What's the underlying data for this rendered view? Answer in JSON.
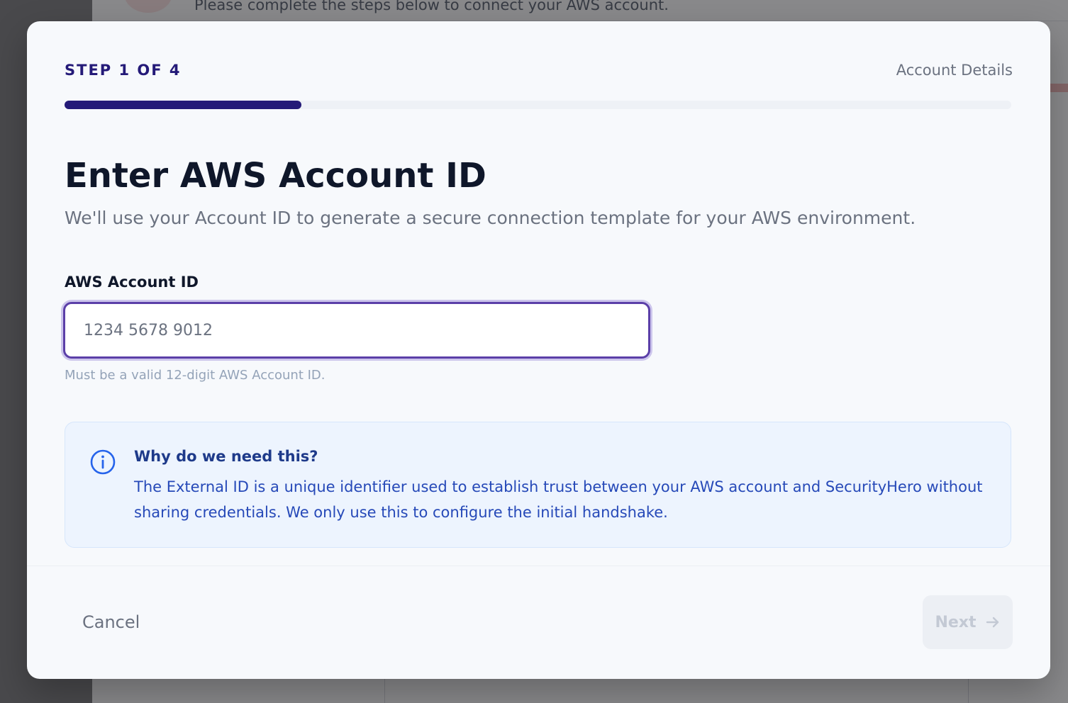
{
  "background": {
    "subtitle": "Please complete the steps below to connect your AWS account."
  },
  "modal": {
    "step_label": "STEP 1 OF 4",
    "step_name": "Account Details",
    "progress": {
      "current": 1,
      "total": 4,
      "fraction": 0.25
    },
    "title": "Enter AWS Account ID",
    "subtitle": "We'll use your Account ID to generate a secure connection template for your AWS environment.",
    "field": {
      "label": "AWS Account ID",
      "value": "",
      "placeholder": "1234 5678 9012",
      "help": "Must be a valid 12-digit AWS Account ID."
    },
    "info": {
      "icon": "info-circle-icon",
      "title": "Why do we need this?",
      "body": "The External ID is a unique identifier used to establish trust between your AWS account and SecurityHero without sharing credentials. We only use this to configure the initial handshake."
    },
    "footer": {
      "cancel_label": "Cancel",
      "next_label": "Next",
      "next_icon": "arrow-right-icon",
      "next_disabled": true
    }
  },
  "colors": {
    "accent": "#241a78",
    "focus_ring": "#5b3fa8",
    "info_bg": "#edf4fe",
    "info_text": "#2649b8"
  }
}
